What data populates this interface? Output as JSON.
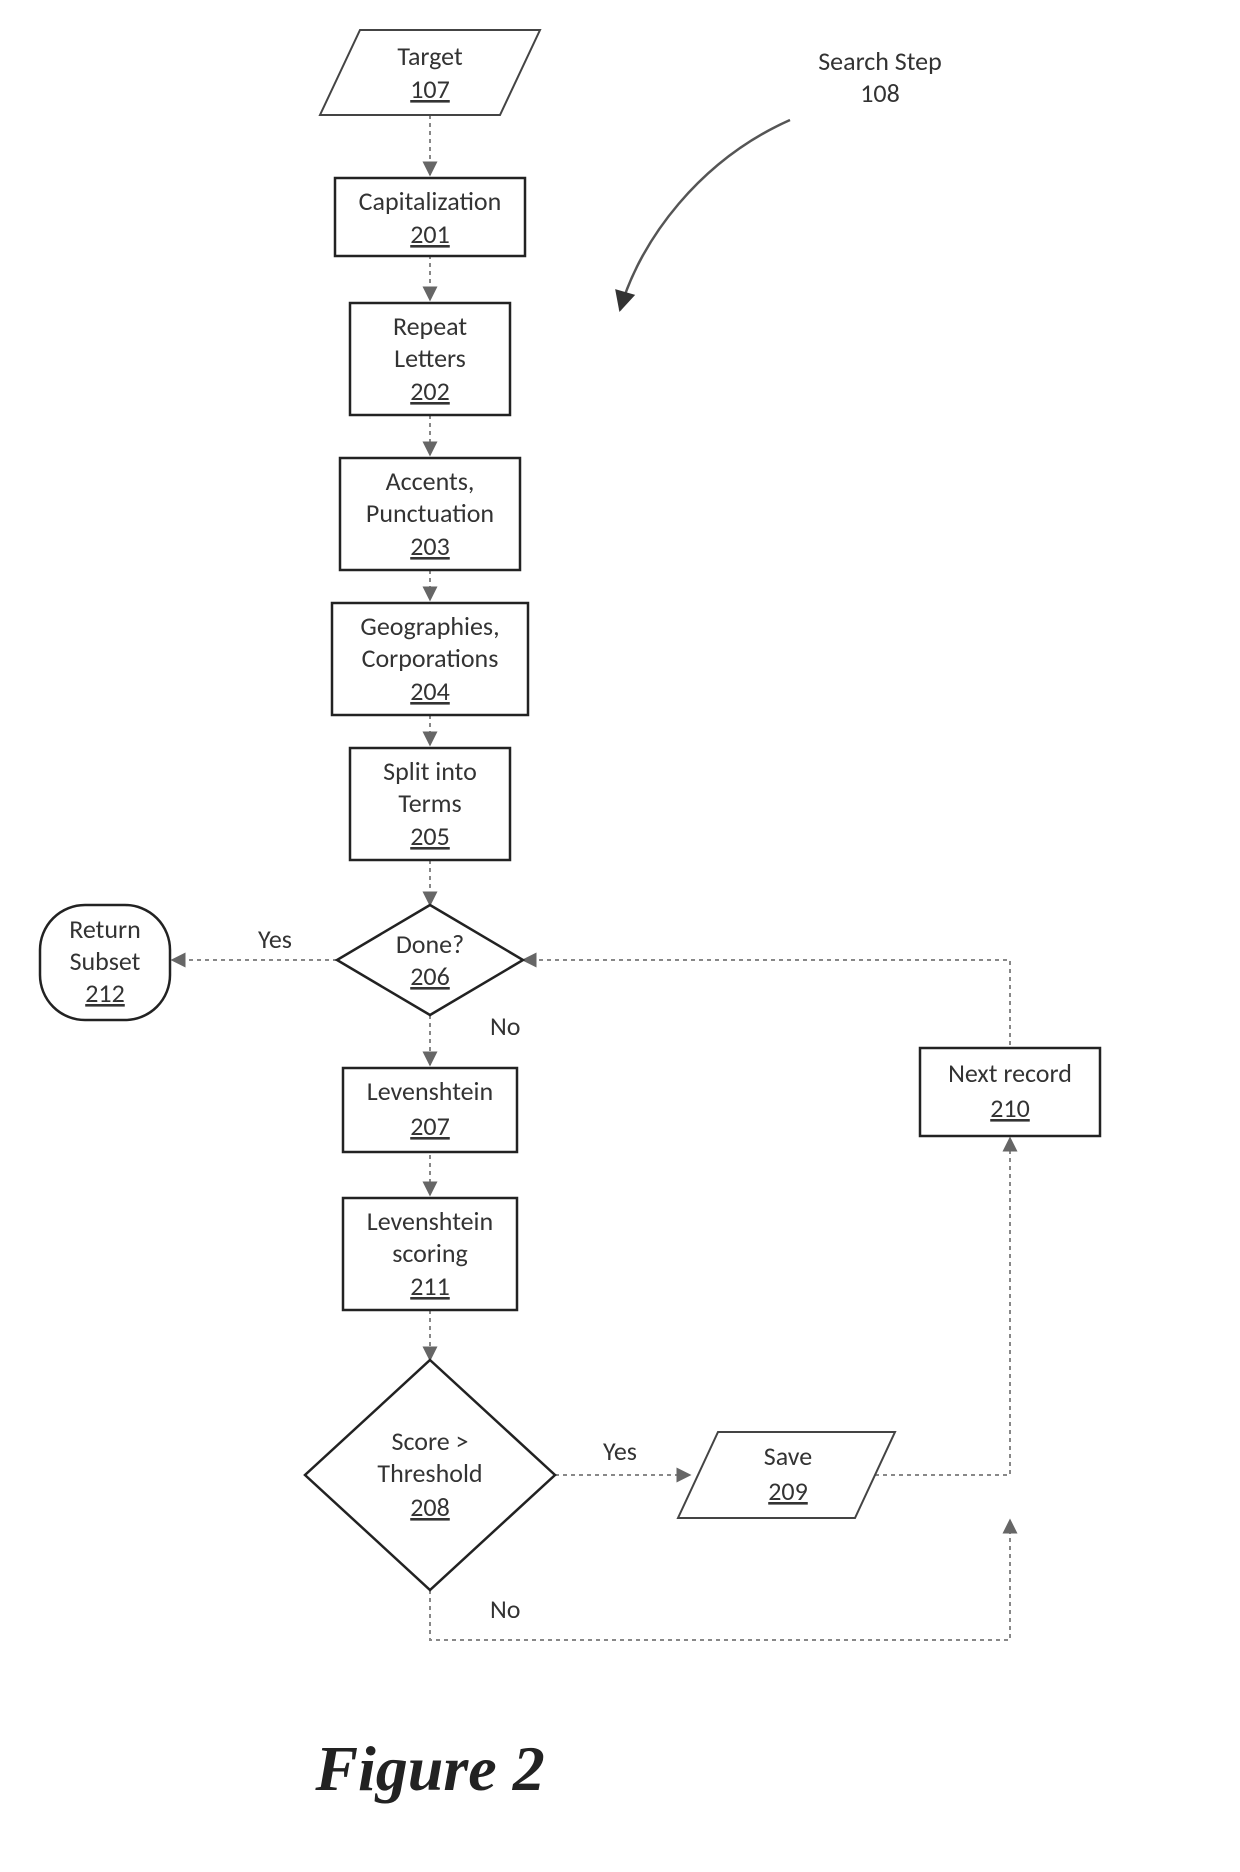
{
  "figure": {
    "caption": "Figure 2"
  },
  "annotation": {
    "label_line1": "Search Step",
    "label_ref": "108"
  },
  "nodes": {
    "target": {
      "label": "Target",
      "ref": "107"
    },
    "capitalization": {
      "label": "Capitalization",
      "ref": "201"
    },
    "repeat": {
      "line1": "Repeat",
      "line2": "Letters",
      "ref": "202"
    },
    "accents": {
      "line1": "Accents,",
      "line2": "Punctuation",
      "ref": "203"
    },
    "geos": {
      "line1": "Geographies,",
      "line2": "Corporations",
      "ref": "204"
    },
    "split": {
      "line1": "Split into",
      "line2": "Terms",
      "ref": "205"
    },
    "done": {
      "label": "Done?",
      "ref": "206"
    },
    "leven": {
      "label": "Levenshtein",
      "ref": "207"
    },
    "levenscore": {
      "line1": "Levenshtein",
      "line2": "scoring",
      "ref": "211"
    },
    "threshold": {
      "line1": "Score >",
      "line2": "Threshold",
      "ref": "208"
    },
    "save": {
      "label": "Save",
      "ref": "209"
    },
    "next": {
      "label": "Next record",
      "ref": "210"
    },
    "return": {
      "line1": "Return",
      "line2": "Subset",
      "ref": "212"
    }
  },
  "edges": {
    "yes": "Yes",
    "no": "No"
  }
}
